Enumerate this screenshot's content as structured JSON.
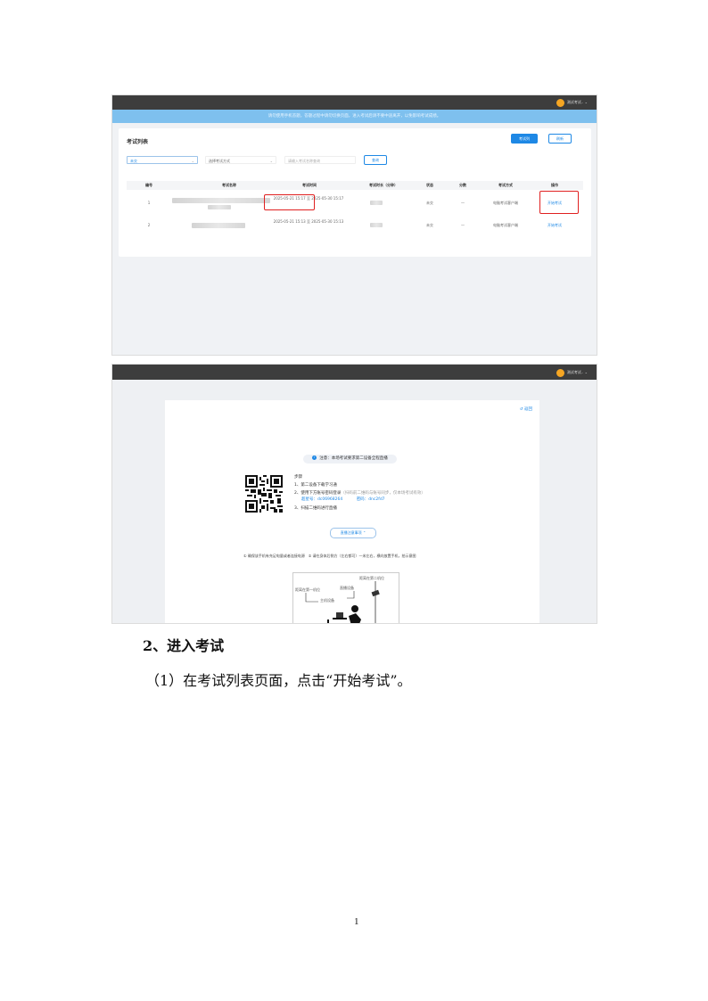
{
  "screenshot1": {
    "user_menu": "测试考试.. ⌄",
    "notice": "请勿使用手机答题，答题过程中请勿切换页面，进入考试后请不要中途离开，以免影响考试成绩。",
    "list_title": "考试列表",
    "btn_exam": "考试列",
    "btn_refresh": "刷新",
    "filter_status": "未交",
    "filter_mode_placeholder": "选择考试方式",
    "search_placeholder": "请输入考试名称查询",
    "search_btn": "查询",
    "columns": [
      "编号",
      "考试名称",
      "考试时间",
      "考试时长（分钟）",
      "状态",
      "分数",
      "考试方式",
      "操作"
    ],
    "rows": [
      {
        "no": "1",
        "time": "2025-05-21 15:17 至 2025-05-30 15:17",
        "status": "未交",
        "score": "—",
        "mode": "电脑考试客户端",
        "action": "开始考试"
      },
      {
        "no": "2",
        "time": "2025-05-21 15:13 至 2025-05-30 15:13",
        "status": "未交",
        "score": "—",
        "mode": "电脑考试客户端",
        "action": "开始考试"
      }
    ]
  },
  "screenshot2": {
    "user_menu": "测试考试.. ⌄",
    "back": "↺ 返回",
    "notice": "注意：本场考试要求第二设备全程直播",
    "steps_title": "步骤",
    "step1": "1、第二设备下载学习通",
    "step2": "2、使用下方账号密码登录",
    "step2_sub": "（扫码前二维码与账号同步，仅本场考试有效）",
    "account_label": "超星号：",
    "account": "dc06968264",
    "password_label": "密码：",
    "password": "dnc2fd7",
    "step3": "3、扫描二维码进行直播",
    "collapse_btn": "直播注意事项 ⌃",
    "tip1": "① 确保该手机有充足电量或者连接电源",
    "tip2": "② 请在身体后侧方（左右都可）一米左右，横向放置手机，拍示意图",
    "illus_label1": "直播设备",
    "illus_label2": "距离在第二机位",
    "illus_label3": "主机设备",
    "illus_label4": "距离在第一机位"
  },
  "heading": "2、进入考试",
  "paragraph": "（1）在考试列表页面，点击“开始考试”。",
  "page_number": "1",
  "colors": {
    "accent": "#1e88e5",
    "highlight": "#e02020",
    "notice_bg": "#7ec0ee",
    "topbar": "#3d3d3d"
  }
}
